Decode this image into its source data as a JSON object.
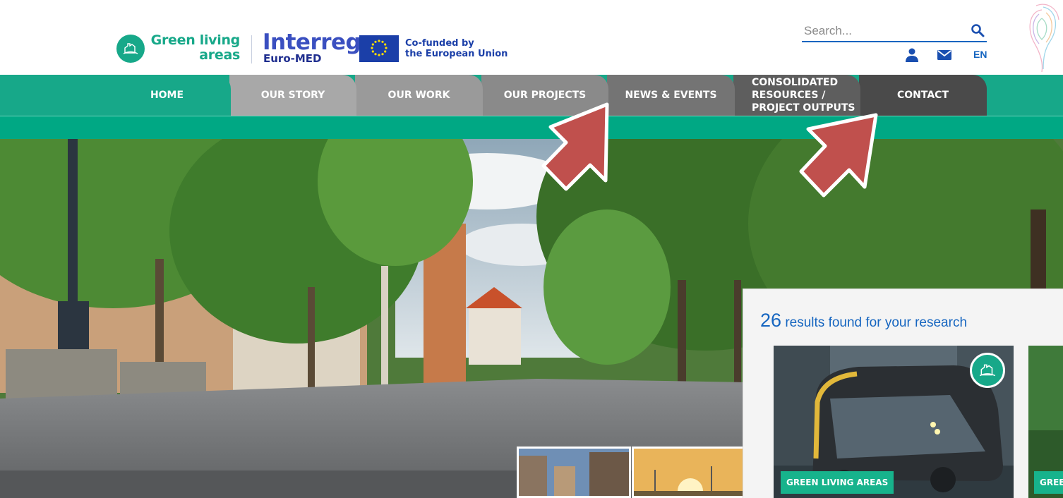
{
  "header": {
    "brand_line1": "Green living",
    "brand_line2": "areas",
    "interreg": "Interreg",
    "euromed": "Euro-MED",
    "eu_line1": "Co-funded by",
    "eu_line2": "the European Union",
    "search_placeholder": "Search...",
    "language": "EN"
  },
  "nav": {
    "tabs": [
      {
        "label": "HOME",
        "color": "#17a889"
      },
      {
        "label": "OUR STORY",
        "color": "#a8a8a8"
      },
      {
        "label": "OUR WORK",
        "color": "#9a9a9a"
      },
      {
        "label": "OUR PROJECTS",
        "color": "#8a8a8a"
      },
      {
        "label": "NEWS & EVENTS",
        "color": "#747474"
      },
      {
        "label_lines": [
          "CONSOLIDATED",
          "RESOURCES /",
          "PROJECT OUTPUTS"
        ],
        "color": "#5e5e5e"
      },
      {
        "label": "CONTACT",
        "color": "#4a4a4a"
      }
    ]
  },
  "results_panel": {
    "count": "26",
    "text": "results found for your research",
    "cards": [
      {
        "badge": "GREEN LIVING AREAS"
      },
      {
        "badge": "GREE"
      }
    ]
  },
  "colors": {
    "brand_green": "#17a889",
    "nav_strip": "#00a884",
    "link_blue": "#1565c0",
    "annotation_arrow": "#c0504d"
  }
}
